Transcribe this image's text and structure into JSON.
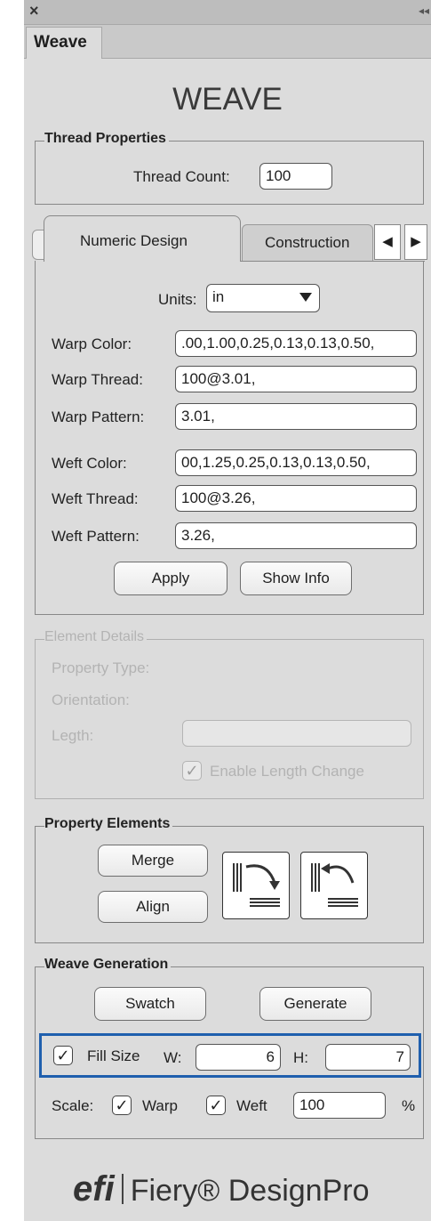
{
  "panel": {
    "tab_label": "Weave",
    "close_glyph": "×",
    "collapse_glyph": "◂◂",
    "title": "WEAVE"
  },
  "thread_properties": {
    "legend": "Thread Properties",
    "thread_count_label": "Thread Count:",
    "thread_count_value": "100"
  },
  "design_tabs": {
    "tabs": [
      "Numeric Design",
      "Construction"
    ],
    "active": "Numeric Design"
  },
  "numeric_design": {
    "units_label": "Units:",
    "units_value": "in",
    "warp_color_label": "Warp Color:",
    "warp_color_value": ".00,1.00,0.25,0.13,0.13,0.50,",
    "warp_thread_label": "Warp Thread:",
    "warp_thread_value": "100@3.01,",
    "warp_pattern_label": "Warp Pattern:",
    "warp_pattern_value": "3.01,",
    "weft_color_label": "Weft Color:",
    "weft_color_value": "00,1.25,0.25,0.13,0.13,0.50,",
    "weft_thread_label": "Weft Thread:",
    "weft_thread_value": "100@3.26,",
    "weft_pattern_label": "Weft Pattern:",
    "weft_pattern_value": "3.26,",
    "apply_label": "Apply",
    "show_info_label": "Show Info"
  },
  "element_details": {
    "legend": "Element Details",
    "property_type_label": "Property Type:",
    "orientation_label": "Orientation:",
    "length_label": "Legth:",
    "enable_length_label": "Enable Length Change"
  },
  "property_elements": {
    "legend": "Property Elements",
    "merge_label": "Merge",
    "align_label": "Align"
  },
  "weave_generation": {
    "legend": "Weave Generation",
    "swatch_label": "Swatch",
    "generate_label": "Generate",
    "fill_size_label": "Fill Size",
    "w_label": "W:",
    "w_value": "6",
    "h_label": "H:",
    "h_value": "7",
    "scale_label": "Scale:",
    "warp_label": "Warp",
    "weft_label": "Weft",
    "scale_value": "100",
    "percent_label": "%"
  },
  "brand": {
    "efi": "efi",
    "product": "Fiery® DesignPro"
  },
  "colors": {
    "panel_bg": "#dcdcdc",
    "highlight": "#1f5fae"
  },
  "icons": [
    "close-icon",
    "dropdown-arrow-icon",
    "tab-scroll-left-icon",
    "tab-scroll-right-icon",
    "checkmark-icon",
    "rotate-right-icon",
    "rotate-left-icon"
  ]
}
